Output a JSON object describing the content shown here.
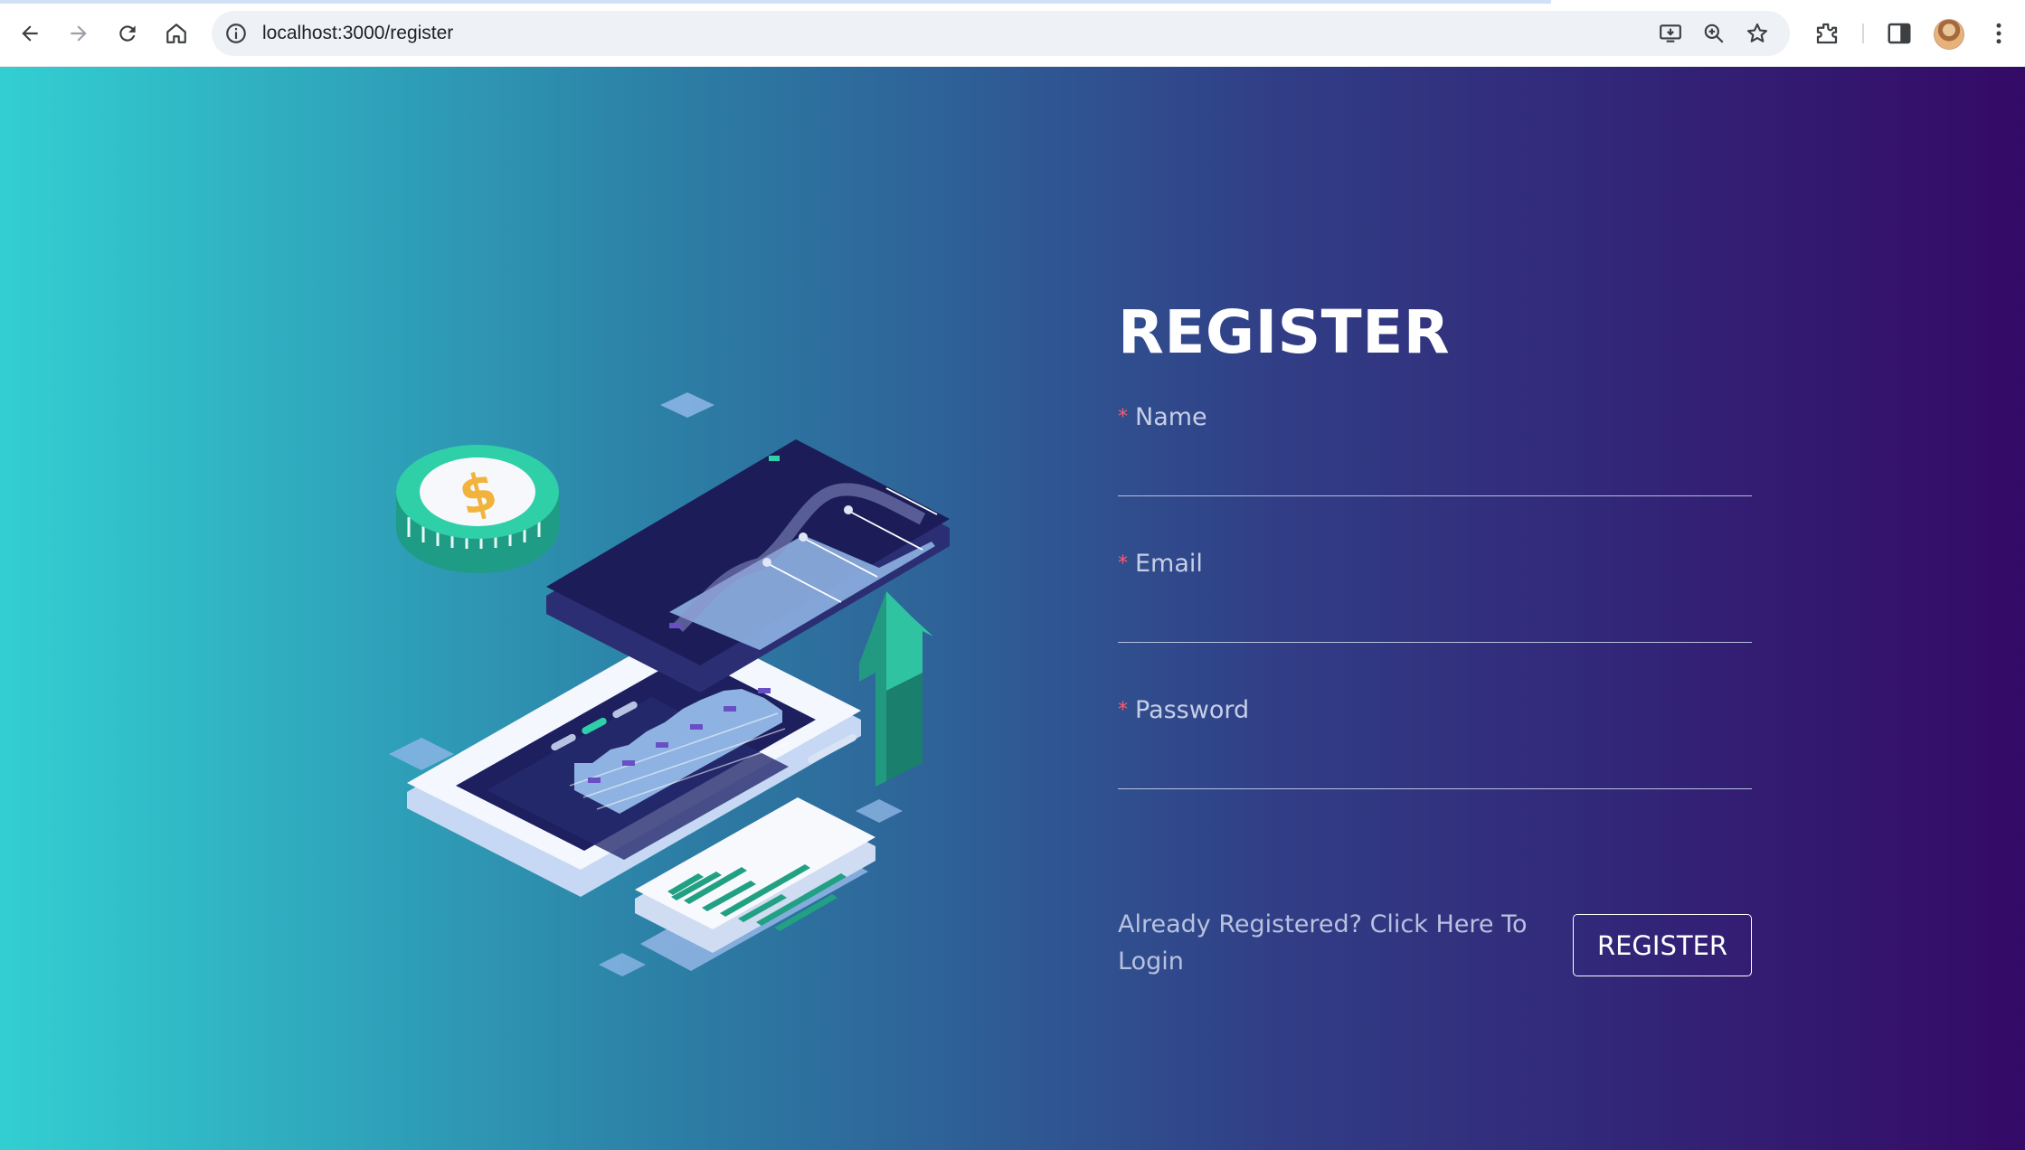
{
  "browser": {
    "url": "localhost:3000/register",
    "icons": [
      "back-icon",
      "forward-icon",
      "reload-icon",
      "home-icon",
      "site-info-icon",
      "install-app-icon",
      "zoom-icon",
      "bookmark-star-icon",
      "extensions-icon",
      "side-panel-icon",
      "profile-avatar",
      "menu-icon"
    ]
  },
  "form": {
    "title": "REGISTER",
    "fields": [
      {
        "label": "Name",
        "required": true,
        "value": ""
      },
      {
        "label": "Email",
        "required": true,
        "value": ""
      },
      {
        "label": "Password",
        "required": true,
        "value": ""
      }
    ],
    "required_mark": "*",
    "login_link": "Already Registered? Click Here To Login",
    "submit_label": "REGISTER"
  },
  "illustration": {
    "coin_symbol": "$"
  },
  "colors": {
    "gradient_start": "#32cfd2",
    "gradient_mid": "#2c7fa6",
    "gradient_end": "#340a67",
    "required_mark": "#ff5a6e",
    "coin": "#2fcfa8",
    "arrow": "#229a82"
  }
}
